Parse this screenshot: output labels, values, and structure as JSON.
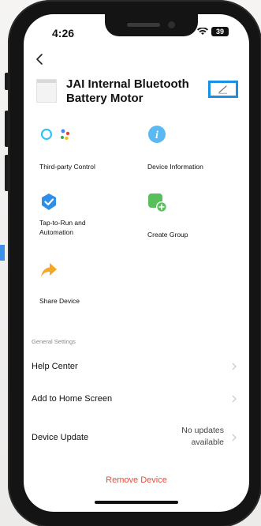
{
  "status_bar": {
    "time": "4:26",
    "battery": "39"
  },
  "device": {
    "name": "JAI Internal Bluetooth Battery Motor"
  },
  "tiles": [
    {
      "label": "Third-party Control",
      "icon": "alexa-google-icon"
    },
    {
      "label": "Device Information",
      "icon": "info-icon"
    },
    {
      "label": "Tap-to-Run and\nAutomation",
      "icon": "tap-to-run-icon"
    },
    {
      "label": "Create Group",
      "icon": "create-group-icon"
    },
    {
      "label": "Share Device",
      "icon": "share-icon"
    }
  ],
  "general_settings": {
    "header": "General Settings",
    "rows": [
      {
        "label": "Help Center"
      },
      {
        "label": "Add to Home Screen"
      },
      {
        "label": "Device Update",
        "value": "No updates\navailable"
      }
    ]
  },
  "remove_label": "Remove Device",
  "colors": {
    "accent_blue": "#1a8fe6",
    "info_blue": "#5ab8f2",
    "automation_blue": "#2f8fe8",
    "group_green": "#57c05a",
    "share_orange": "#f5a623",
    "danger_red": "#e74c3c"
  }
}
